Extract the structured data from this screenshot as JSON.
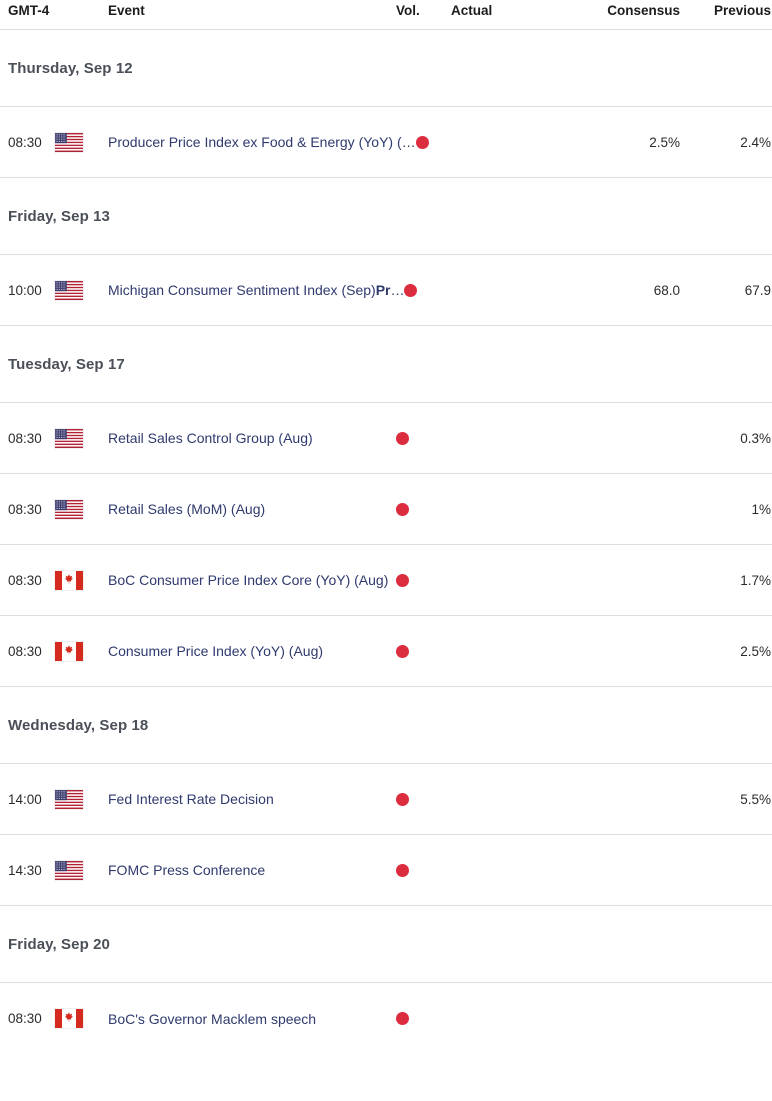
{
  "columns": {
    "time": "GMT-4",
    "event": "Event",
    "volatility": "Vol.",
    "actual": "Actual",
    "consensus": "Consensus",
    "previous": "Previous"
  },
  "colors": {
    "volatility_high": "#dc2d3f",
    "event_link": "#2f3a6e",
    "day_header": "#4a4f58",
    "row_divider": "#dcdee1"
  },
  "sections": [
    {
      "date_label": "Thursday, Sep 12",
      "rows": [
        {
          "time": "08:30",
          "flag": "us-flag-icon",
          "country": "United States",
          "event": "Producer Price Index ex Food & Energy (YoY) (",
          "event_suffix_bold": "",
          "truncated": true,
          "volatility": "high",
          "actual": "",
          "consensus": "2.5%",
          "previous": "2.4%"
        }
      ]
    },
    {
      "date_label": "Friday, Sep 13",
      "rows": [
        {
          "time": "10:00",
          "flag": "us-flag-icon",
          "country": "United States",
          "event": "Michigan Consumer Sentiment Index (Sep)",
          "event_suffix_bold": "Pr",
          "truncated": true,
          "volatility": "high",
          "actual": "",
          "consensus": "68.0",
          "previous": "67.9"
        }
      ]
    },
    {
      "date_label": "Tuesday, Sep 17",
      "rows": [
        {
          "time": "08:30",
          "flag": "us-flag-icon",
          "country": "United States",
          "event": "Retail Sales Control Group (Aug)",
          "event_suffix_bold": "",
          "truncated": false,
          "volatility": "high",
          "actual": "",
          "consensus": "",
          "previous": "0.3%"
        },
        {
          "time": "08:30",
          "flag": "us-flag-icon",
          "country": "United States",
          "event": "Retail Sales (MoM) (Aug)",
          "event_suffix_bold": "",
          "truncated": false,
          "volatility": "high",
          "actual": "",
          "consensus": "",
          "previous": "1%"
        },
        {
          "time": "08:30",
          "flag": "ca-flag-icon",
          "country": "Canada",
          "event": "BoC Consumer Price Index Core (YoY) (Aug)",
          "event_suffix_bold": "",
          "truncated": false,
          "volatility": "high",
          "actual": "",
          "consensus": "",
          "previous": "1.7%"
        },
        {
          "time": "08:30",
          "flag": "ca-flag-icon",
          "country": "Canada",
          "event": "Consumer Price Index (YoY) (Aug)",
          "event_suffix_bold": "",
          "truncated": false,
          "volatility": "high",
          "actual": "",
          "consensus": "",
          "previous": "2.5%"
        }
      ]
    },
    {
      "date_label": "Wednesday, Sep 18",
      "rows": [
        {
          "time": "14:00",
          "flag": "us-flag-icon",
          "country": "United States",
          "event": "Fed Interest Rate Decision",
          "event_suffix_bold": "",
          "truncated": false,
          "volatility": "high",
          "actual": "",
          "consensus": "",
          "previous": "5.5%"
        },
        {
          "time": "14:30",
          "flag": "us-flag-icon",
          "country": "United States",
          "event": "FOMC Press Conference",
          "event_suffix_bold": "",
          "truncated": false,
          "volatility": "high",
          "actual": "",
          "consensus": "",
          "previous": ""
        }
      ]
    },
    {
      "date_label": "Friday, Sep 20",
      "rows": [
        {
          "time": "08:30",
          "flag": "ca-flag-icon",
          "country": "Canada",
          "event": "BoC's Governor Macklem speech",
          "event_suffix_bold": "",
          "truncated": false,
          "volatility": "high",
          "actual": "",
          "consensus": "",
          "previous": ""
        }
      ]
    }
  ]
}
